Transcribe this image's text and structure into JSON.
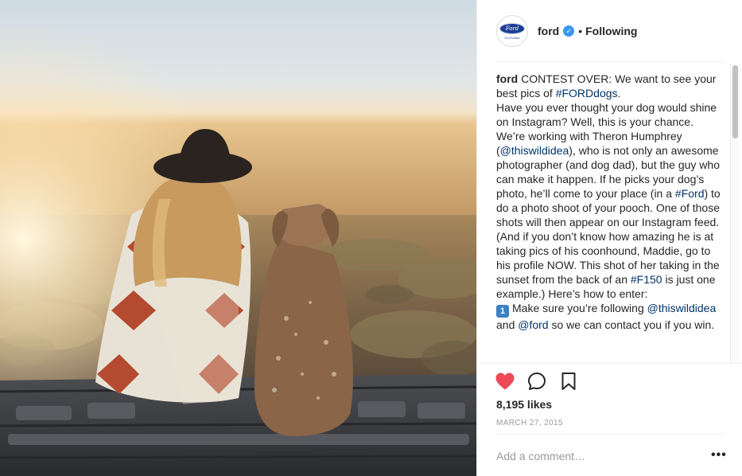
{
  "post": {
    "photo_icon": "woman-and-dog-on-truck-bed-photo"
  },
  "header": {
    "avatar_logo_text": "Ford",
    "avatar_tagline": "Go Further",
    "username": "ford",
    "verified_icon": "verified-badge-icon",
    "separator": "•",
    "follow_status": "Following"
  },
  "caption": {
    "author": "ford",
    "parts": [
      {
        "type": "text",
        "value": " CONTEST OVER: We want to see your best pics of "
      },
      {
        "type": "tag",
        "value": "#FORDdogs"
      },
      {
        "type": "text",
        "value": ".\nHave you ever thought your dog would shine on Instagram? Well, this is your chance. We’re working with Theron Humphrey ("
      },
      {
        "type": "tag",
        "value": "@thiswildidea"
      },
      {
        "type": "text",
        "value": "), who is not only an awesome photographer (and dog dad), but the guy who can make it happen. If he picks your dog’s photo, he’ll come to your place (in a "
      },
      {
        "type": "tag",
        "value": "#Ford"
      },
      {
        "type": "text",
        "value": ") to do a photo shoot of your pooch. One of those shots will then appear on our Instagram feed. (And if you don’t know how amazing he is at taking pics of his coonhound, Maddie, go to his profile NOW. This shot of her taking in the sunset from the back of an "
      },
      {
        "type": "tag",
        "value": "#F150"
      },
      {
        "type": "text",
        "value": " is just one example.) Here’s how to enter:\n"
      },
      {
        "type": "keycap",
        "value": "1"
      },
      {
        "type": "text",
        "value": "Make sure you’re following "
      },
      {
        "type": "tag",
        "value": "@thiswildidea"
      },
      {
        "type": "text",
        "value": " and "
      },
      {
        "type": "tag",
        "value": "@ford"
      },
      {
        "type": "text",
        "value": " so we can contact you if you win."
      }
    ]
  },
  "actions": {
    "like_icon": "heart-filled-icon",
    "comment_icon": "comment-bubble-icon",
    "save_icon": "bookmark-icon",
    "like_color": "#ed4956"
  },
  "likes": "8,195 likes",
  "date": "MARCH 27, 2015",
  "comment": {
    "placeholder": "Add a comment…",
    "more_label": "•••"
  }
}
